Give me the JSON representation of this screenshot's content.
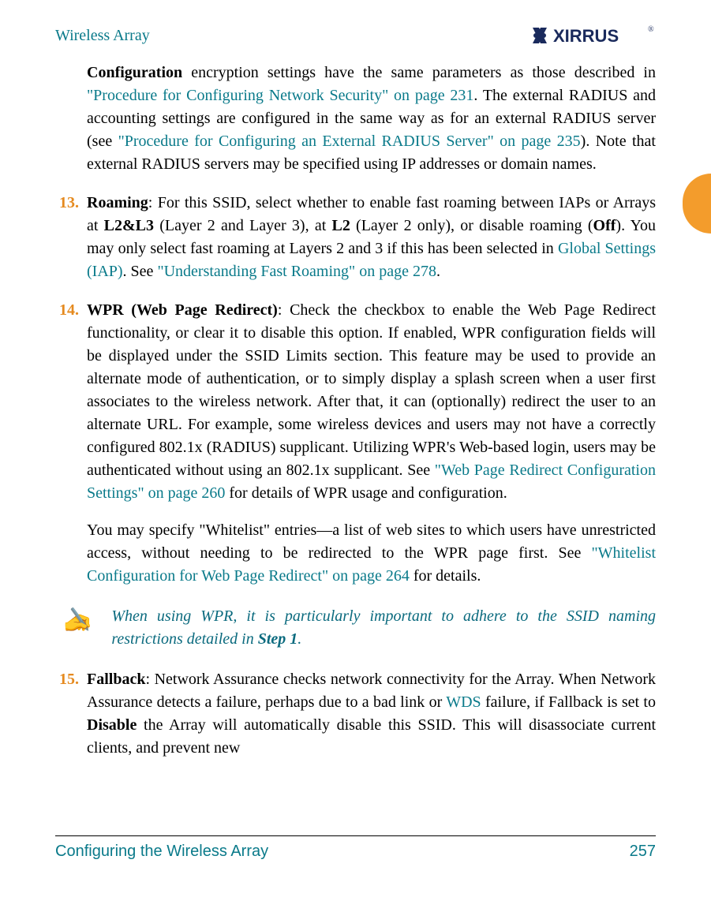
{
  "header": {
    "title": "Wireless Array",
    "logo_text": "XIRRUS"
  },
  "intro_para": {
    "lead_bold": "Configuration",
    "t1": " encryption settings have the same parameters as those described in ",
    "link1": "\"Procedure for Configuring Network Security\" on page 231",
    "t2": ". The external RADIUS and accounting settings are configured in the same way as for an external RADIUS server (see ",
    "link2": "\"Procedure for Configuring an External RADIUS Server\" on page 235",
    "t3": "). Note that external RADIUS servers may be specified using IP addresses or domain names."
  },
  "item13": {
    "num": "13.",
    "bold1": "Roaming",
    "t1": ": For this SSID, select whether to enable fast roaming between IAPs or Arrays at ",
    "bold2": "L2&L3",
    "t2": " (Layer 2 and Layer 3), at ",
    "bold3": "L2",
    "t3": " (Layer 2 only), or disable roaming (",
    "bold4": "Off",
    "t4": "). You may only select fast roaming at Layers 2 and 3 if this has been selected in ",
    "link1": "Global Settings (IAP)",
    "t5": ". See ",
    "link2": "\"Understanding Fast Roaming\" on page 278",
    "t6": "."
  },
  "item14": {
    "num": "14.",
    "bold1": "WPR (Web Page Redirect)",
    "t1": ": Check the checkbox to enable the Web Page Redirect functionality, or clear it to disable this option. If enabled, WPR configuration fields will be displayed under the SSID Limits section. This feature may be used to provide an alternate mode of authentication, or to simply display a splash screen when a user first associates to the wireless network. After that, it can (optionally) redirect the user to an alternate URL. For example, some wireless devices and users may not have a correctly configured 802.1x (RADIUS) supplicant. Utilizing WPR's Web-based login, users may be authenticated without using an 802.1x supplicant. See ",
    "link1": "\"Web Page Redirect Configuration Settings\" on page 260",
    "t2": " for details of WPR usage and configuration.",
    "p2a": "You may specify \"Whitelist\" entries—a list of web sites to which users have unrestricted access, without needing to be redirected to the WPR page first. See ",
    "p2link": "\"Whitelist Configuration for Web Page Redirect\" on page 264",
    "p2b": " for details."
  },
  "note": {
    "t1": "When using WPR, it is particularly important to adhere to the SSID naming restrictions detailed in ",
    "step": "Step 1",
    "t2": "."
  },
  "item15": {
    "num": "15.",
    "bold1": "Fallback",
    "t1": ": Network Assurance checks network connectivity for the Array. When Network Assurance detects a failure, perhaps due to a bad link or ",
    "link1": "WDS",
    "t2": " failure, if Fallback is set to ",
    "bold2": "Disable",
    "t3": " the Array will automatically disable this SSID. This will disassociate current clients, and prevent new"
  },
  "footer": {
    "left": "Configuring the Wireless Array",
    "right": "257"
  }
}
